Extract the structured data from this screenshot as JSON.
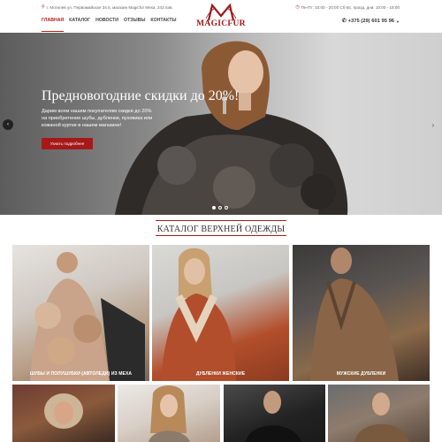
{
  "header": {
    "address": "г. Могилев ул. Первомайская 34 в, магазин Magicfur Меха, 243 пав.",
    "hours": "Пн-Пт: 10:00 - 20:00 Сб-Вс, празд. дни: 10:00 - 19:00",
    "phone": "+375 (29) 601 95 96",
    "logo_letter": "M",
    "logo_text": "MAGICFUR",
    "nav": [
      "ГЛАВНАЯ",
      "КАТАЛОГ",
      "НОВОСТИ",
      "ОТЗЫВЫ",
      "КОНТАКТЫ"
    ]
  },
  "hero": {
    "title": "Предновогодние скидки до 20%!",
    "text": "Дарим всем нашим покупателям скидки до 20% на приобретение шубы, дубленки, пуховика или кожаной куртки в нашем магазине!",
    "button": "Узнать подробнее",
    "slides": 3,
    "active_slide": 0
  },
  "catalog": {
    "title": "КАТАЛОГ ВЕРХНЕЙ ОДЕЖДЫ",
    "cards": [
      {
        "label": "ШУБЫ И ПОЛУШУБКИ (АВТОЛЕДИ) ИЗ МЕХА"
      },
      {
        "label": "ДУБЛЕНКИ ЖЕНСКИЕ"
      },
      {
        "label": "МУЖСКИЕ ДУБЛЕНКИ"
      },
      {
        "label": ""
      },
      {
        "label": ""
      },
      {
        "label": ""
      },
      {
        "label": ""
      }
    ]
  },
  "colors": {
    "accent": "#a51919",
    "logo": "#a01818"
  },
  "icons": {
    "address": "map-pin-icon",
    "hours": "clock-icon",
    "phone": "phone-icon",
    "prev": "chevron-left-icon",
    "next": "chevron-right-icon"
  }
}
